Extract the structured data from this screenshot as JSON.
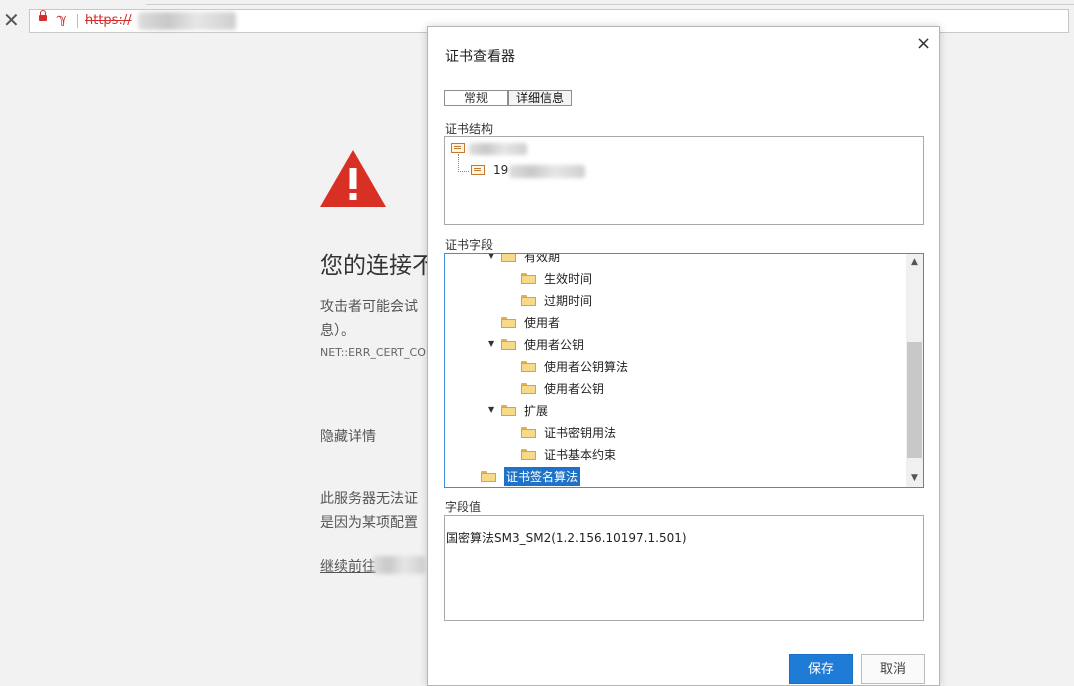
{
  "browser": {
    "url_prefix": "https://"
  },
  "page": {
    "headline": "您的连接不",
    "line1": "攻击者可能会试",
    "line2": "息）。",
    "error_code": "NET::ERR_CERT_CO",
    "hide_details": "隐藏详情",
    "desc1": "此服务器无法证",
    "desc2": "是因为某项配置",
    "continue_link": "继续前往"
  },
  "dialog": {
    "title": "证书查看器",
    "close": "×",
    "tabs": [
      "常规",
      "详细信息"
    ],
    "structure_label": "证书结构",
    "structure_child_prefix": "19",
    "fields_label": "证书字段",
    "fields": [
      {
        "label": "有效期",
        "indent": 2,
        "expanded": true
      },
      {
        "label": "生效时间",
        "indent": 3
      },
      {
        "label": "过期时间",
        "indent": 3
      },
      {
        "label": "使用者",
        "indent": 2
      },
      {
        "label": "使用者公钥",
        "indent": 2,
        "expanded": true
      },
      {
        "label": "使用者公钥算法",
        "indent": 3
      },
      {
        "label": "使用者公钥",
        "indent": 3
      },
      {
        "label": "扩展",
        "indent": 2,
        "expanded": true
      },
      {
        "label": "证书密钥用法",
        "indent": 3
      },
      {
        "label": "证书基本约束",
        "indent": 3
      },
      {
        "label": "证书签名算法",
        "indent": 1,
        "selected": true
      }
    ],
    "value_label": "字段值",
    "value_text": "国密算法SM3_SM2(1.2.156.10197.1.501)",
    "save": "保存",
    "cancel": "取消"
  },
  "colors": {
    "accent": "#1e7bd6",
    "error": "#d32f2f",
    "selected": "#1e73c9"
  }
}
